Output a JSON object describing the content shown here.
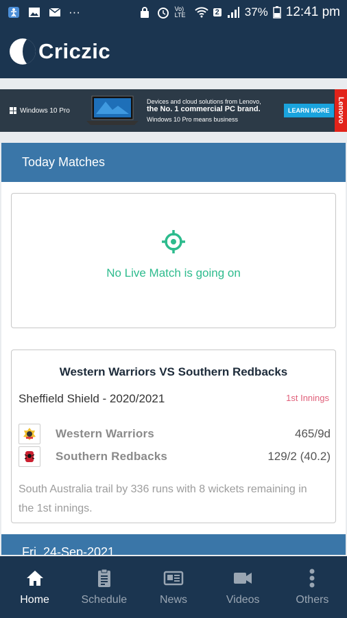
{
  "status_bar": {
    "battery": "37%",
    "time": "12:41 pm",
    "sim_badge": "2",
    "network": "Vo) LTE",
    "more": "···"
  },
  "app": {
    "name": "Criczic"
  },
  "ad": {
    "os_label": "Windows 10 Pro",
    "line1": "Devices and cloud solutions from Lenovo,",
    "line2": "the No. 1 commercial PC brand.",
    "line3": "Windows 10 Pro means business",
    "button": "LEARN MORE",
    "brand": "Lenovo"
  },
  "today": {
    "heading": "Today Matches",
    "no_live_text": "No Live Match is going on"
  },
  "match": {
    "title": "Western Warriors VS Southern Redbacks",
    "series": "Sheffield Shield - 2020/2021",
    "status": "1st Innings",
    "teams": [
      {
        "name": "Western Warriors",
        "score": "465/9d"
      },
      {
        "name": "Southern Redbacks",
        "score": "129/2 (40.2)"
      }
    ],
    "summary": "South Australia trail by 336 runs with 8 wickets remaining in the 1st innings."
  },
  "next_date": "Fri, 24-Sep-2021",
  "nav": [
    {
      "label": "Home",
      "icon": "home-icon",
      "active": true
    },
    {
      "label": "Schedule",
      "icon": "clipboard-icon",
      "active": false
    },
    {
      "label": "News",
      "icon": "newspaper-icon",
      "active": false
    },
    {
      "label": "Videos",
      "icon": "video-camera-icon",
      "active": false
    },
    {
      "label": "Others",
      "icon": "more-vertical-icon",
      "active": false
    }
  ],
  "colors": {
    "header": "#1b3550",
    "section": "#3a76a8",
    "accent_green": "#2dbb8d",
    "innings_pink": "#e0607a"
  }
}
